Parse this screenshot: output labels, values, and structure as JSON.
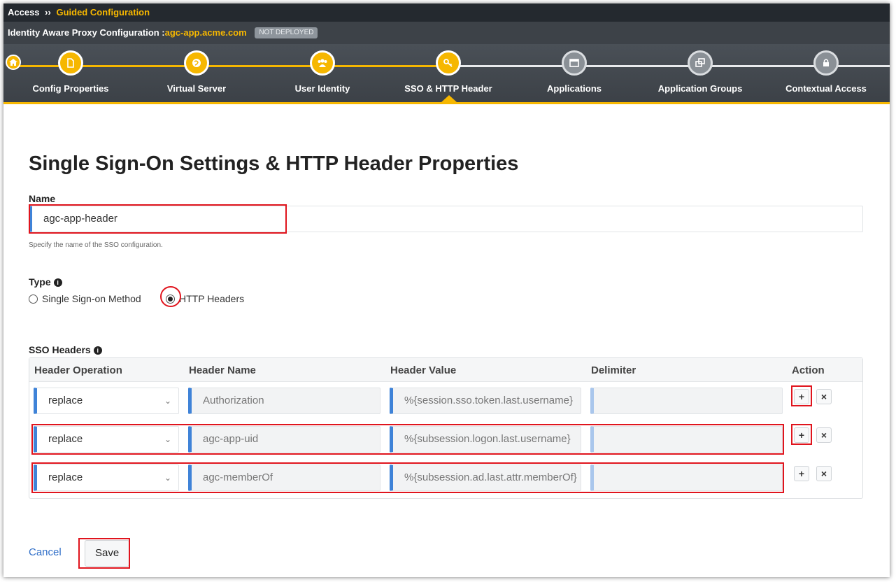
{
  "breadcrumb": {
    "root": "Access",
    "separator": "››",
    "current": "Guided Configuration"
  },
  "subheader": {
    "prefix": "Identity Aware Proxy Configuration :",
    "host": "agc-app.acme.com",
    "status": "NOT DEPLOYED"
  },
  "wizard": {
    "steps": [
      {
        "label": "Config Properties",
        "icon": "document-icon",
        "state": "done"
      },
      {
        "label": "Virtual Server",
        "icon": "globe-icon",
        "state": "done"
      },
      {
        "label": "User Identity",
        "icon": "users-icon",
        "state": "done"
      },
      {
        "label": "SSO & HTTP Header",
        "icon": "key-icon",
        "state": "current"
      },
      {
        "label": "Applications",
        "icon": "window-icon",
        "state": "todo"
      },
      {
        "label": "Application Groups",
        "icon": "windows-group-icon",
        "state": "todo"
      },
      {
        "label": "Contextual Access",
        "icon": "lock-icon",
        "state": "todo"
      }
    ]
  },
  "page": {
    "title": "Single Sign-On Settings & HTTP Header Properties"
  },
  "name_field": {
    "label": "Name",
    "value": "agc-app-header",
    "help": "Specify the name of the SSO configuration."
  },
  "type_field": {
    "label": "Type",
    "options": [
      {
        "label": "Single Sign-on Method",
        "selected": false
      },
      {
        "label": "HTTP Headers",
        "selected": true
      }
    ]
  },
  "sso_headers": {
    "label": "SSO Headers",
    "columns": [
      "Header Operation",
      "Header Name",
      "Header Value",
      "Delimiter",
      "Action"
    ],
    "rows": [
      {
        "operation": "replace",
        "name": "Authorization",
        "value": "%{session.sso.token.last.username}",
        "delimiter": ""
      },
      {
        "operation": "replace",
        "name": "agc-app-uid",
        "value": "%{subsession.logon.last.username}",
        "delimiter": ""
      },
      {
        "operation": "replace",
        "name": "agc-memberOf",
        "value": "%{subsession.ad.last.attr.memberOf}",
        "delimiter": ""
      }
    ],
    "add_label": "+",
    "remove_label": "×"
  },
  "footer": {
    "cancel": "Cancel",
    "save": "Save"
  },
  "colors": {
    "accent": "#f6b700",
    "input_marker": "#3f83d8",
    "highlight": "#e0141d"
  }
}
